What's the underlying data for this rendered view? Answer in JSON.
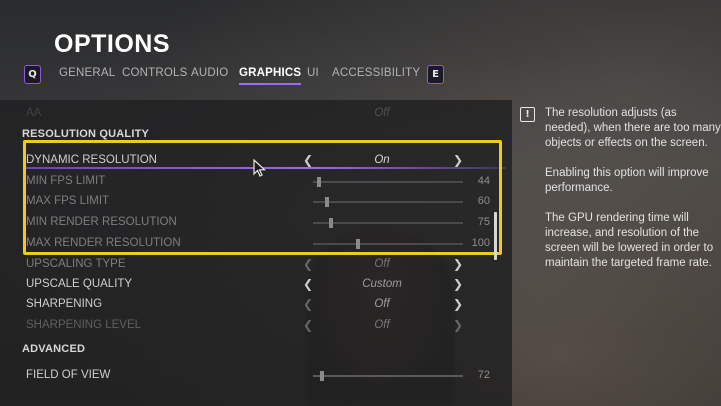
{
  "page": {
    "title": "OPTIONS"
  },
  "tabs": {
    "prev_key": "Q",
    "next_key": "E",
    "items": [
      {
        "label": "GENERAL"
      },
      {
        "label": "CONTROLS"
      },
      {
        "label": "AUDIO"
      },
      {
        "label": "GRAPHICS",
        "active": true
      },
      {
        "label": "UI"
      },
      {
        "label": "ACCESSIBILITY"
      }
    ]
  },
  "settings": {
    "top_cut": {
      "label": "AA",
      "value": "Off"
    },
    "section_resolution": "RESOLUTION QUALITY",
    "dynamic_resolution": {
      "label": "DYNAMIC RESOLUTION",
      "value": "On"
    },
    "min_fps": {
      "label": "MIN FPS LIMIT",
      "value": "44",
      "level": 0.04
    },
    "max_fps": {
      "label": "MAX FPS LIMIT",
      "value": "60",
      "level": 0.09
    },
    "min_render": {
      "label": "MIN RENDER RESOLUTION",
      "value": "75",
      "level": 0.12
    },
    "max_render": {
      "label": "MAX RENDER RESOLUTION",
      "value": "100",
      "level": 0.3
    },
    "upscaling_type": {
      "label": "UPSCALING TYPE",
      "value": "Off"
    },
    "upscale_quality": {
      "label": "UPSCALE QUALITY",
      "value": "Custom"
    },
    "sharpening": {
      "label": "SHARPENING",
      "value": "Off"
    },
    "sharpening_level": {
      "label": "SHARPENING LEVEL",
      "value": "Off"
    },
    "section_advanced": "ADVANCED",
    "field_of_view": {
      "label": "FIELD OF VIEW",
      "value": "72",
      "level": 0.06
    }
  },
  "info": {
    "p1": "The resolution adjusts (as needed), when there are too many objects or effects on the screen.",
    "p2": "Enabling this option will improve performance.",
    "p3": "The GPU rendering time will increase, and resolution of the screen will be lowered in order to maintain the targeted frame rate."
  },
  "colors": {
    "accent": "#9c6bf2",
    "highlight": "#f2c91d"
  }
}
